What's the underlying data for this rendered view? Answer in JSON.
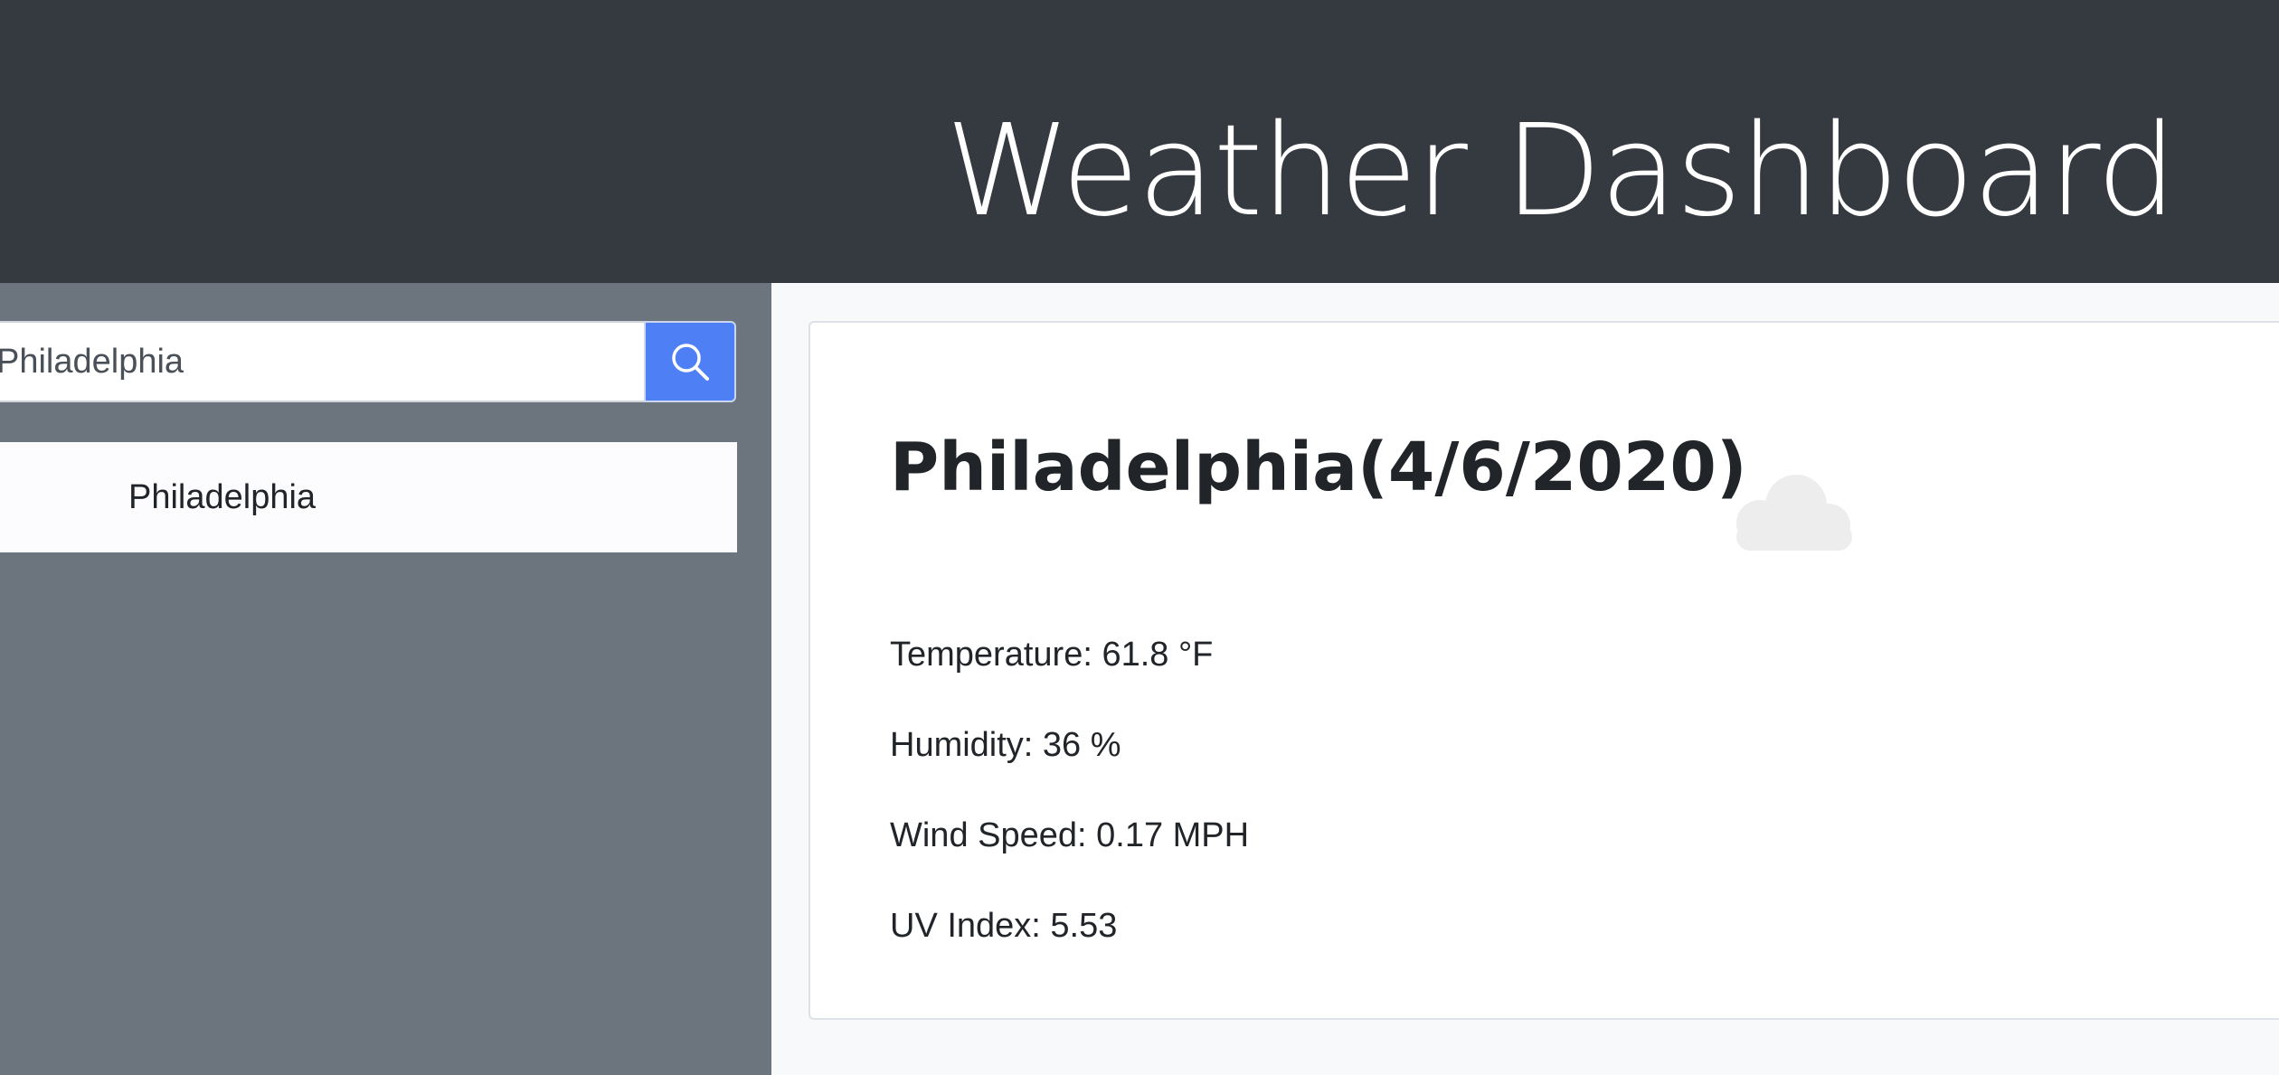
{
  "header": {
    "title": "Weather Dashboard"
  },
  "sidebar": {
    "search": {
      "value": "Philadelphia",
      "button_icon": "search-icon"
    },
    "history": [
      {
        "label": "Philadelphia"
      }
    ]
  },
  "current": {
    "heading": "Philadelphia(4/6/2020)",
    "icon": "cloud-icon",
    "temperature": "Temperature: 61.8 °F",
    "humidity": "Humidity: 36 %",
    "wind_speed": "Wind Speed: 0.17 MPH",
    "uv_index": "UV Index: 5.53"
  },
  "colors": {
    "header_bg": "#343a40",
    "sidebar_bg": "#6c757d",
    "button_bg": "#4f7ff5",
    "main_bg": "#f8f9fa"
  }
}
